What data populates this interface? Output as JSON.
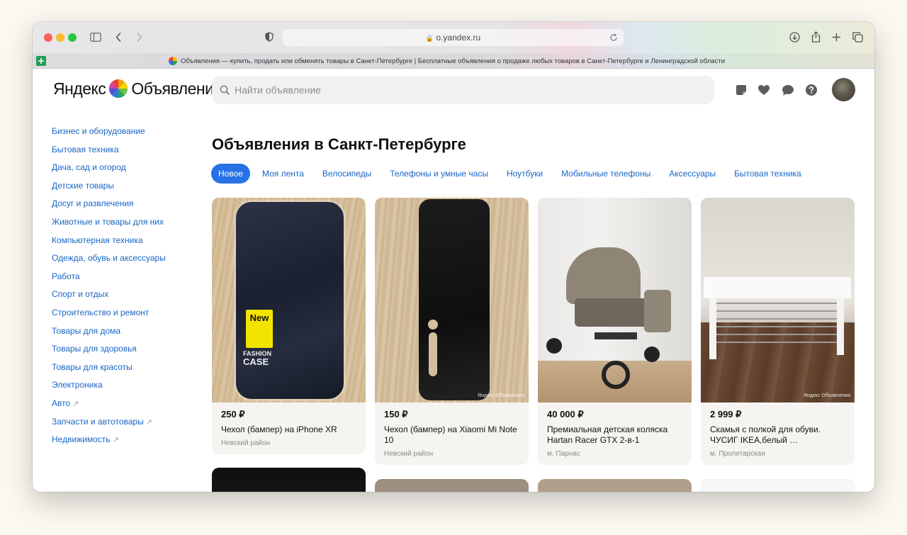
{
  "browser": {
    "address_url": "o.yandex.ru",
    "tab_title": "Объявления — купить, продать или обменять товары в Санкт-Петербурге | Бесплатные объявления о продаже любых товаров в Санкт-Петербурге и Ленинградской области"
  },
  "header": {
    "logo_text": "Яндекс",
    "logo_service": "Объявления",
    "search_placeholder": "Найти объявление"
  },
  "sidebar": {
    "items": [
      {
        "label": "Бизнес и оборудование"
      },
      {
        "label": "Бытовая техника"
      },
      {
        "label": "Дача, сад и огород"
      },
      {
        "label": "Детские товары"
      },
      {
        "label": "Досуг и развлечения"
      },
      {
        "label": "Животные и товары для них"
      },
      {
        "label": "Компьютерная техника"
      },
      {
        "label": "Одежда, обувь и аксессуары"
      },
      {
        "label": "Работа"
      },
      {
        "label": "Спорт и отдых"
      },
      {
        "label": "Строительство и ремонт"
      },
      {
        "label": "Товары для дома"
      },
      {
        "label": "Товары для здоровья"
      },
      {
        "label": "Товары для красоты"
      },
      {
        "label": "Электроника"
      },
      {
        "label": "Авто",
        "external": "↗"
      },
      {
        "label": "Запчасти и автотовары",
        "external": "↗"
      },
      {
        "label": "Недвижимость",
        "external": "↗"
      }
    ]
  },
  "main": {
    "heading": "Объявления в Санкт-Петербурге",
    "chips": [
      "Новое",
      "Моя лента",
      "Велосипеды",
      "Телефоны и умные часы",
      "Ноутбуки",
      "Мобильные телефоны",
      "Аксессуары",
      "Бытовая техника"
    ],
    "listings": [
      {
        "price": "250 ₽",
        "title": "Чехол (бампер) на iPhone XR",
        "location": "Невский район",
        "sticker_line1": "New",
        "sticker_line2": "FASHION",
        "sticker_line3": "CASE",
        "image_note": "case-navy"
      },
      {
        "price": "150 ₽",
        "title": "Чехол (бампер) на Xiaomi Mi Note 10",
        "location": "Невский район",
        "image_note": "case-black"
      },
      {
        "price": "40 000 ₽",
        "title": "Премиальная детская коляска Hartan Racer GTX 2-в-1",
        "location": "м. Парнас",
        "image_note": "stroller"
      },
      {
        "price": "2 999 ₽",
        "title": "Скамья с полкой для обуви. ЧУСИГ IKEA,белый …",
        "location": "м. Пролетарская",
        "image_note": "bench"
      }
    ],
    "watermark": "Яндекс Объявления"
  }
}
